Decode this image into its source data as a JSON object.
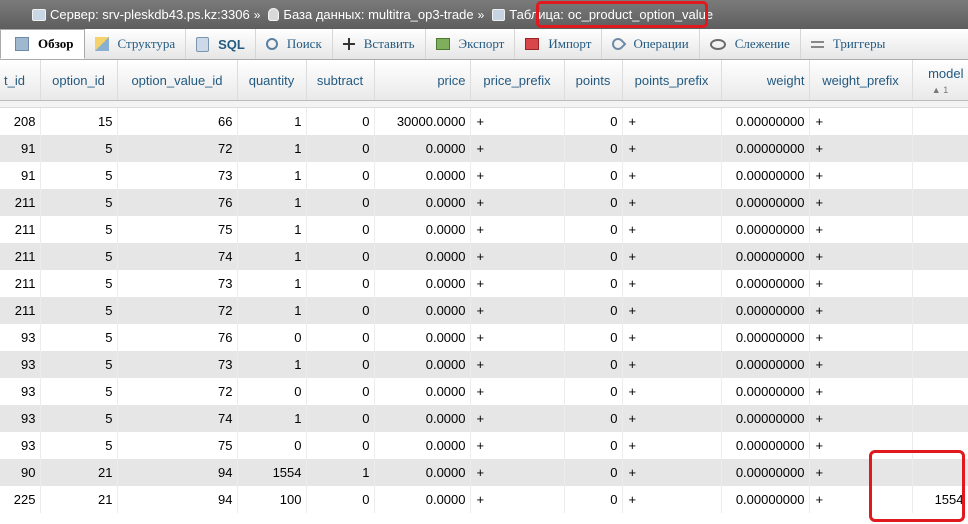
{
  "breadcrumb": {
    "server": "Сервер: srv-pleskdb43.ps.kz:3306",
    "database": "База данных: multitra_op3-trade",
    "table_label": "Таблица:",
    "table_name": "oc_product_option_value",
    "separator": "»"
  },
  "tabs": [
    {
      "label": "Обзор",
      "icon": "browse-icon",
      "active": true
    },
    {
      "label": "Структура",
      "icon": "structure-icon"
    },
    {
      "label": "SQL",
      "icon": "sql-icon"
    },
    {
      "label": "Поиск",
      "icon": "search-icon"
    },
    {
      "label": "Вставить",
      "icon": "insert-icon"
    },
    {
      "label": "Экспорт",
      "icon": "export-icon"
    },
    {
      "label": "Импорт",
      "icon": "import-icon"
    },
    {
      "label": "Операции",
      "icon": "operations-icon"
    },
    {
      "label": "Слежение",
      "icon": "tracking-icon"
    },
    {
      "label": "Триггеры",
      "icon": "triggers-icon"
    }
  ],
  "table": {
    "columns": [
      {
        "label": "t_id"
      },
      {
        "label": "option_id"
      },
      {
        "label": "option_value_id"
      },
      {
        "label": "quantity"
      },
      {
        "label": "subtract"
      },
      {
        "label": "price"
      },
      {
        "label": "price_prefix"
      },
      {
        "label": "points"
      },
      {
        "label": "points_prefix"
      },
      {
        "label": "weight"
      },
      {
        "label": "weight_prefix"
      },
      {
        "label": "model",
        "sort": "▲ 1"
      }
    ],
    "rows": [
      [
        "208",
        "15",
        "66",
        "1",
        "0",
        "30000.0000",
        "+",
        "0",
        "+",
        "0.00000000",
        "+",
        ""
      ],
      [
        "91",
        "5",
        "72",
        "1",
        "0",
        "0.0000",
        "+",
        "0",
        "+",
        "0.00000000",
        "+",
        ""
      ],
      [
        "91",
        "5",
        "73",
        "1",
        "0",
        "0.0000",
        "+",
        "0",
        "+",
        "0.00000000",
        "+",
        ""
      ],
      [
        "211",
        "5",
        "76",
        "1",
        "0",
        "0.0000",
        "+",
        "0",
        "+",
        "0.00000000",
        "+",
        ""
      ],
      [
        "211",
        "5",
        "75",
        "1",
        "0",
        "0.0000",
        "+",
        "0",
        "+",
        "0.00000000",
        "+",
        ""
      ],
      [
        "211",
        "5",
        "74",
        "1",
        "0",
        "0.0000",
        "+",
        "0",
        "+",
        "0.00000000",
        "+",
        ""
      ],
      [
        "211",
        "5",
        "73",
        "1",
        "0",
        "0.0000",
        "+",
        "0",
        "+",
        "0.00000000",
        "+",
        ""
      ],
      [
        "211",
        "5",
        "72",
        "1",
        "0",
        "0.0000",
        "+",
        "0",
        "+",
        "0.00000000",
        "+",
        ""
      ],
      [
        "93",
        "5",
        "76",
        "0",
        "0",
        "0.0000",
        "+",
        "0",
        "+",
        "0.00000000",
        "+",
        ""
      ],
      [
        "93",
        "5",
        "73",
        "1",
        "0",
        "0.0000",
        "+",
        "0",
        "+",
        "0.00000000",
        "+",
        ""
      ],
      [
        "93",
        "5",
        "72",
        "0",
        "0",
        "0.0000",
        "+",
        "0",
        "+",
        "0.00000000",
        "+",
        ""
      ],
      [
        "93",
        "5",
        "74",
        "1",
        "0",
        "0.0000",
        "+",
        "0",
        "+",
        "0.00000000",
        "+",
        ""
      ],
      [
        "93",
        "5",
        "75",
        "0",
        "0",
        "0.0000",
        "+",
        "0",
        "+",
        "0.00000000",
        "+",
        ""
      ],
      [
        "90",
        "21",
        "94",
        "1554",
        "1",
        "0.0000",
        "+",
        "0",
        "+",
        "0.00000000",
        "+",
        ""
      ],
      [
        "225",
        "21",
        "94",
        "100",
        "0",
        "0.0000",
        "+",
        "0",
        "+",
        "0.00000000",
        "+",
        "1554"
      ]
    ]
  }
}
